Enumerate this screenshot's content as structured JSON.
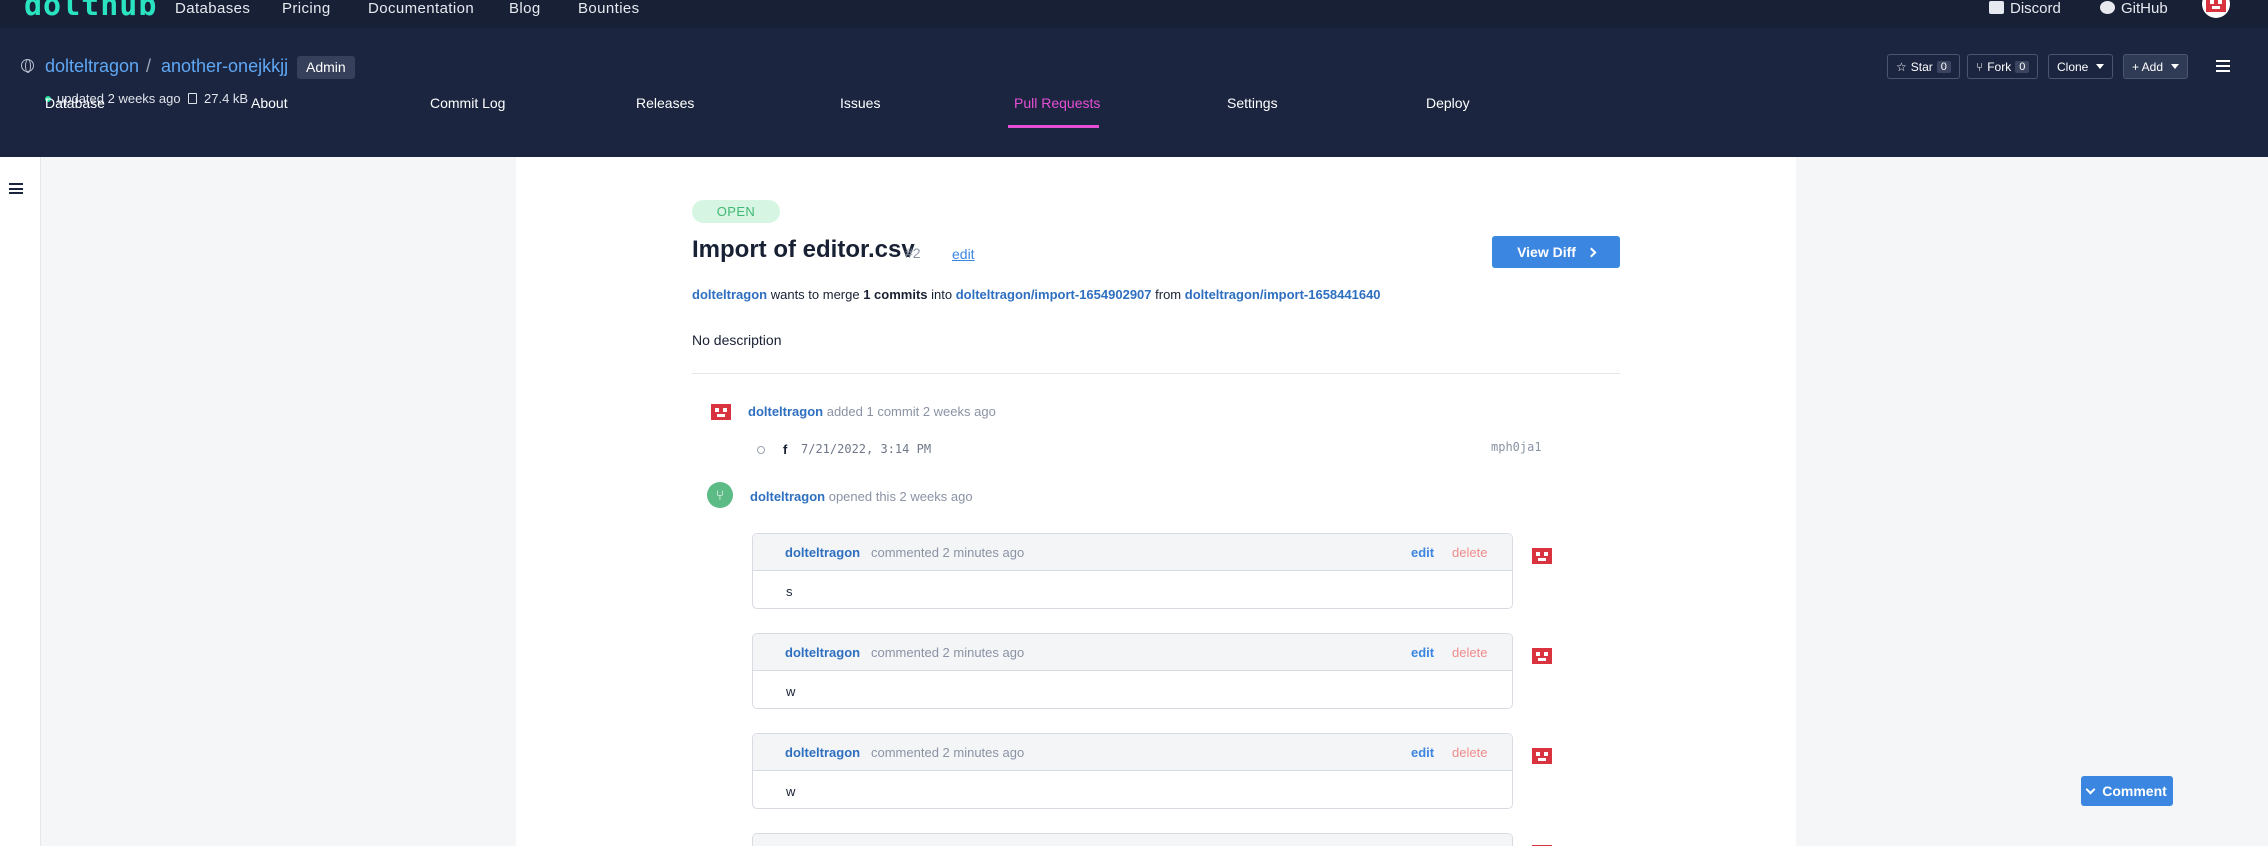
{
  "topnav": {
    "logo": "dolthub",
    "links": [
      "Databases",
      "Pricing",
      "Documentation",
      "Blog",
      "Bounties"
    ],
    "discord": "Discord",
    "github": "GitHub"
  },
  "repo": {
    "owner": "dolteltragon",
    "separator": "/",
    "name": "another-onejkkjj",
    "role": "Admin",
    "updated": "updated 2 weeks ago",
    "size": "27.4 kB",
    "star_label": "Star",
    "star_count": "0",
    "fork_label": "Fork",
    "fork_count": "0",
    "clone_label": "Clone",
    "add_label": "+ Add"
  },
  "tabs": [
    "Database",
    "About",
    "Commit Log",
    "Releases",
    "Issues",
    "Pull Requests",
    "Settings",
    "Deploy"
  ],
  "active_tab": "Pull Requests",
  "pr": {
    "status": "OPEN",
    "title": "Import of editor.csv",
    "number": "#2",
    "edit_label": "edit",
    "view_diff_label": "View Diff",
    "merge": {
      "author": "dolteltragon",
      "text1": " wants to merge ",
      "commits": "1 commits",
      "text2": " into ",
      "into_branch": "dolteltragon/import-1654902907",
      "text3": " from ",
      "from_branch": "dolteltragon/import-1658441640"
    },
    "description": "No description"
  },
  "events": {
    "commit_event": {
      "author": "dolteltragon",
      "text": " added 1 commit 2 weeks ago"
    },
    "commit": {
      "message": "f",
      "date": "7/21/2022, 3:14 PM",
      "hash": "mph0ja1"
    },
    "open_event": {
      "author": "dolteltragon",
      "text": " opened this 2 weeks ago"
    }
  },
  "comments": [
    {
      "author": "dolteltragon",
      "time": "commented 2 minutes ago",
      "edit": "edit",
      "delete": "delete",
      "body": "s"
    },
    {
      "author": "dolteltragon",
      "time": "commented 2 minutes ago",
      "edit": "edit",
      "delete": "delete",
      "body": "w"
    },
    {
      "author": "dolteltragon",
      "time": "commented 2 minutes ago",
      "edit": "edit",
      "delete": "delete",
      "body": "w"
    }
  ],
  "comment_button": "Comment",
  "colors": {
    "nav_bg": "#172035",
    "header_bg": "#1b2540",
    "accent": "#3b86e0",
    "active_tab": "#e64fd5",
    "logo": "#29e3c1"
  }
}
